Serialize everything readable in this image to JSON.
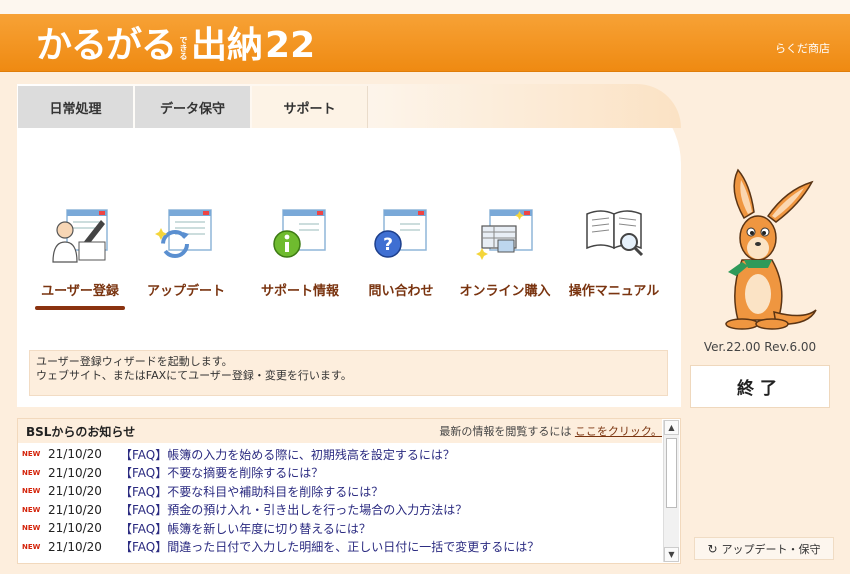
{
  "app": {
    "logo_main": "かるがる",
    "logo_sub": "できる",
    "logo_name": "出納",
    "logo_num": "22",
    "company": "らくだ商店"
  },
  "tabs": [
    {
      "label": "日常処理"
    },
    {
      "label": "データ保守"
    },
    {
      "label": "サポート",
      "active": true
    }
  ],
  "features": [
    {
      "label": "ユーザー登録",
      "icon": "user-registration-icon",
      "selected": true
    },
    {
      "label": "アップデート",
      "icon": "update-icon"
    },
    {
      "label": "サポート情報",
      "icon": "support-info-icon"
    },
    {
      "label": "問い合わせ",
      "icon": "inquiry-icon"
    },
    {
      "label": "オンライン購入",
      "icon": "online-purchase-icon"
    },
    {
      "label": "操作マニュアル",
      "icon": "manual-icon"
    }
  ],
  "description": {
    "line1": "ユーザー登録ウィザードを起動します。",
    "line2": "ウェブサイト、またはFAXにてユーザー登録・変更を行います。"
  },
  "news": {
    "title": "BSLからのお知らせ",
    "link_prefix": "最新の情報を閲覧するには",
    "link_text": "ここをクリック。",
    "items": [
      {
        "badge": "NEW",
        "date": "21/10/20",
        "text": "【FAQ】帳簿の入力を始める際に、初期残高を設定するには？"
      },
      {
        "badge": "NEW",
        "date": "21/10/20",
        "text": "【FAQ】不要な摘要を削除するには？"
      },
      {
        "badge": "NEW",
        "date": "21/10/20",
        "text": "【FAQ】不要な科目や補助科目を削除するには？"
      },
      {
        "badge": "NEW",
        "date": "21/10/20",
        "text": "【FAQ】預金の預け入れ・引き出しを行った場合の入力方法は？"
      },
      {
        "badge": "NEW",
        "date": "21/10/20",
        "text": "【FAQ】帳簿を新しい年度に切り替えるには？"
      },
      {
        "badge": "NEW",
        "date": "21/10/20",
        "text": "【FAQ】間違った日付で入力した明細を、正しい日付に一括で変更するには？"
      }
    ]
  },
  "version": "Ver.22.00 Rev.6.00",
  "exit_label": "終了",
  "update_label": "アップデート・保守",
  "colors": {
    "header": "#ef8a12",
    "accent_text": "#7a3410",
    "new_badge": "#d4240b"
  }
}
